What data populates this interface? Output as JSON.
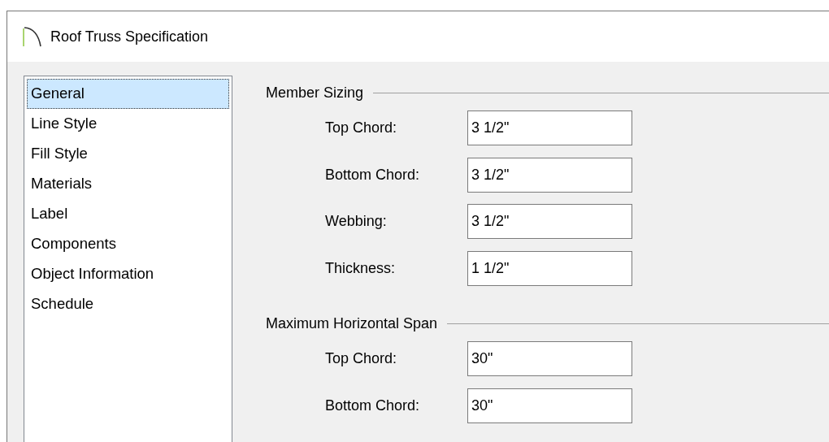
{
  "window": {
    "title": "Roof Truss Specification"
  },
  "sidebar": {
    "items": [
      {
        "label": "General",
        "selected": true
      },
      {
        "label": "Line Style",
        "selected": false
      },
      {
        "label": "Fill Style",
        "selected": false
      },
      {
        "label": "Materials",
        "selected": false
      },
      {
        "label": "Label",
        "selected": false
      },
      {
        "label": "Components",
        "selected": false
      },
      {
        "label": "Object Information",
        "selected": false
      },
      {
        "label": "Schedule",
        "selected": false
      }
    ]
  },
  "groups": [
    {
      "title": "Member Sizing",
      "fields": [
        {
          "label": "Top Chord:",
          "value": "3 1/2\""
        },
        {
          "label": "Bottom Chord:",
          "value": "3 1/2\""
        },
        {
          "label": "Webbing:",
          "value": "3 1/2\""
        },
        {
          "label": "Thickness:",
          "value": "1 1/2\""
        }
      ]
    },
    {
      "title": "Maximum Horizontal Span",
      "fields": [
        {
          "label": "Top Chord:",
          "value": "30\""
        },
        {
          "label": "Bottom Chord:",
          "value": "30\""
        }
      ]
    }
  ]
}
